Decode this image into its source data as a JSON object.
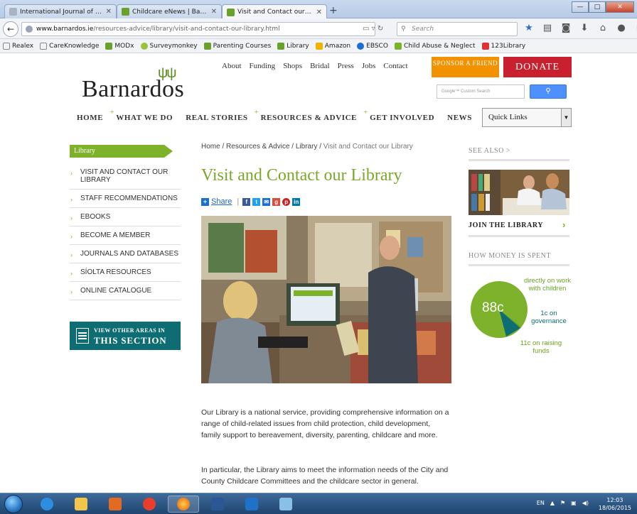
{
  "browser": {
    "tabs": [
      {
        "title": "International Journal of Leaders...",
        "active": false
      },
      {
        "title": "Childcare eNews | Barnard...",
        "active": false
      },
      {
        "title": "Visit and Contact our Libra...",
        "active": true
      }
    ],
    "new_tab": "+",
    "url_host": "www.barnardos.ie",
    "url_path": "/resources-advice/library/visit-and-contact-our-library.html",
    "search_placeholder": "Search",
    "bookmarks": [
      "Realex",
      "CareKnowledge",
      "MODx",
      "Surveymonkey",
      "Parenting Courses",
      "Library",
      "Amazon",
      "EBSCO",
      "Child Abuse & Neglect",
      "123Library"
    ]
  },
  "site": {
    "logo": "Barnardos",
    "top_links": [
      "About",
      "Funding",
      "Shops",
      "Bridal",
      "Press",
      "Jobs",
      "Contact"
    ],
    "sponsor": "SPONSOR A FRIEND",
    "donate": "DONATE",
    "google_placeholder": "Google™ Custom Search",
    "nav": [
      "HOME",
      "WHAT WE DO",
      "REAL STORIES",
      "RESOURCES & ADVICE",
      "GET INVOLVED",
      "NEWS"
    ],
    "quick_links": "Quick Links"
  },
  "sidebar": {
    "section": "Library",
    "items": [
      "VISIT AND CONTACT OUR LIBRARY",
      "STAFF RECOMMENDATIONS",
      "EBOOKS",
      "BECOME A MEMBER",
      "JOURNALS AND DATABASES",
      "SÍOLTA RESOURCES",
      "ONLINE CATALOGUE"
    ],
    "view_other_l1": "VIEW OTHER AREAS IN",
    "view_other_l2": "THIS SECTION"
  },
  "main": {
    "breadcrumb": [
      "Home",
      "Resources & Advice",
      "Library",
      "Visit and Contact our Library"
    ],
    "title": "Visit and Contact our Library",
    "share": "Share",
    "para1": "Our Library is a national service, providing comprehensive information on a range of child-related issues from child protection, child development, family support to bereavement, diversity, parenting, childcare and more.",
    "para2": "In particular, the Library aims to meet the information needs of the City and County Childcare Committees and the childcare sector in general."
  },
  "right": {
    "see_also": "SEE ALSO >",
    "join": "JOIN THE LIBRARY",
    "how_money": "HOW MONEY IS SPENT",
    "pie_big": "88c",
    "pie_direct": "directly on work with children",
    "pie_gov": "1c on governance",
    "pie_raise": "11c on raising funds",
    "pie_shares": {
      "direct": 88,
      "governance": 1,
      "raising": 11
    }
  },
  "taskbar": {
    "lang": "EN",
    "time": "12:03",
    "date": "18/06/2015"
  },
  "colors": {
    "green": "#7db22a",
    "orange": "#f29200",
    "red": "#c8202e",
    "teal": "#0e6d73"
  }
}
